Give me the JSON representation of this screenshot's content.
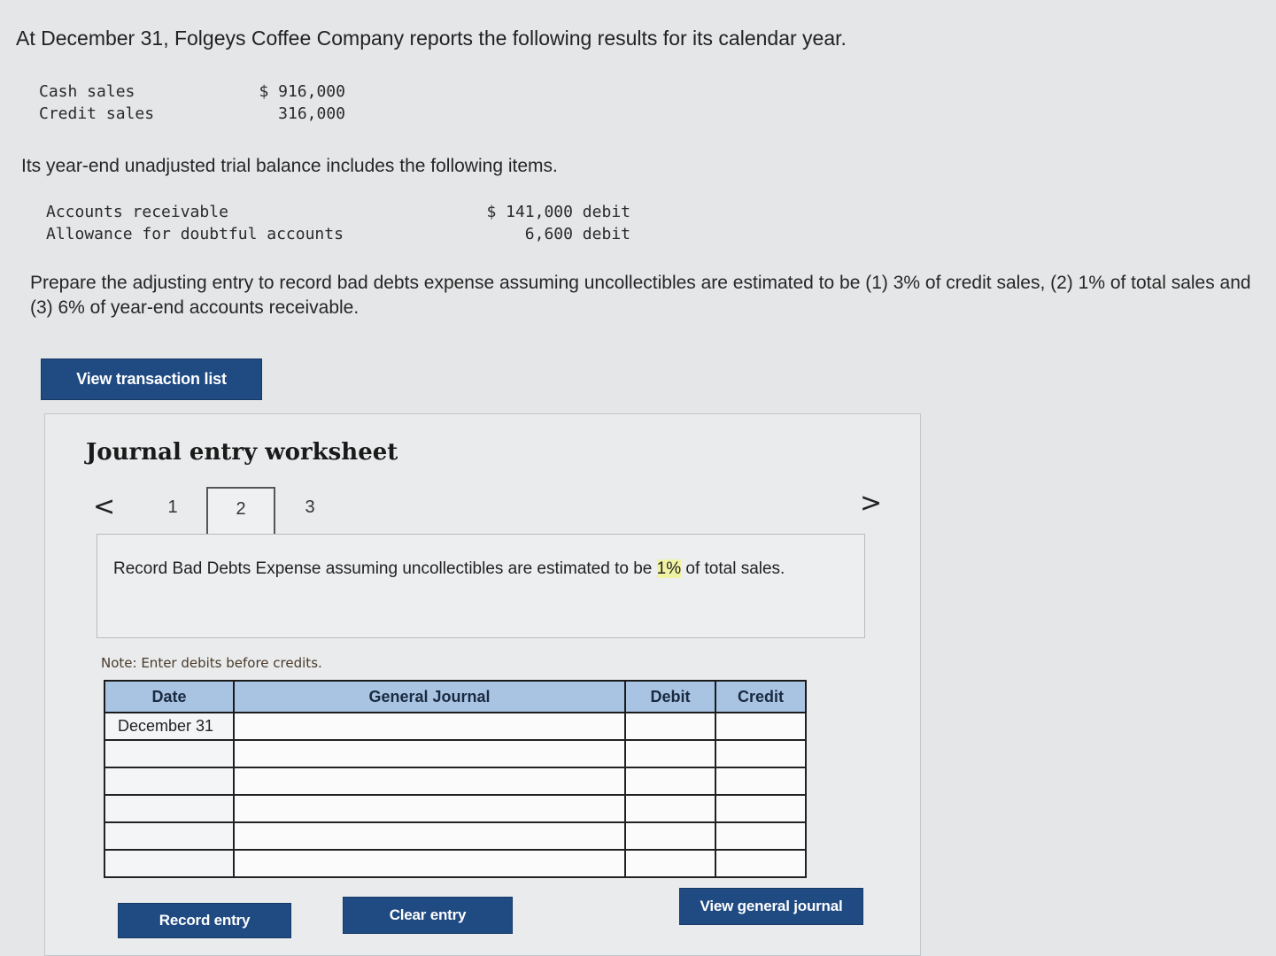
{
  "intro": "At December 31, Folgeys Coffee Company reports the following results for its calendar year.",
  "sales": [
    {
      "label": "Cash sales",
      "value": "$ 916,000"
    },
    {
      "label": "Credit sales",
      "value": "316,000"
    }
  ],
  "trial_intro": "Its year-end unadjusted trial balance includes the following items.",
  "trial": [
    {
      "label": "Accounts receivable",
      "value": "$ 141,000 debit"
    },
    {
      "label": "Allowance for doubtful accounts",
      "value": "6,600 debit"
    }
  ],
  "instructions": "Prepare the adjusting entry to record bad debts expense assuming uncollectibles are estimated to be (1) 3% of credit sales, (2) 1% of total sales and (3) 6% of year-end accounts receivable.",
  "view_transaction_button": "View transaction list",
  "worksheet": {
    "title": "Journal entry worksheet",
    "prev": "<",
    "next": ">",
    "pages": [
      "1",
      "2",
      "3"
    ],
    "active_page": "2",
    "description_part1": "Record Bad Debts Expense assuming uncollectibles are estimated to be ",
    "description_highlight": "1%",
    "description_part2": " of total sales.",
    "note": "Note: Enter debits before credits.",
    "columns": {
      "date": "Date",
      "journal": "General Journal",
      "debit": "Debit",
      "credit": "Credit"
    },
    "rows": [
      {
        "date": "December 31"
      },
      {
        "date": ""
      },
      {
        "date": ""
      },
      {
        "date": ""
      },
      {
        "date": ""
      },
      {
        "date": ""
      }
    ]
  },
  "buttons": {
    "record": "Record entry",
    "clear": "Clear entry",
    "view_journal": "View general journal"
  },
  "colors": {
    "button": "#1f4a82",
    "header": "#a9c4e3"
  }
}
